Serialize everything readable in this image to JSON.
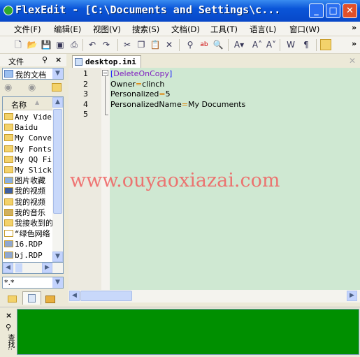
{
  "window": {
    "title": "FlexEdit - [C:\\Documents and Settings\\c...",
    "minimize": "_",
    "maximize": "□",
    "close": "✕"
  },
  "menu": [
    "文件(F)",
    "编辑(E)",
    "视图(V)",
    "搜索(S)",
    "文档(D)",
    "工具(T)",
    "语言(L)",
    "窗口(W)"
  ],
  "menu_overflow": "»",
  "toolbar": {
    "icons": [
      "new-icon",
      "open-icon",
      "save-icon",
      "save-all-icon",
      "print-icon",
      "undo-icon",
      "redo-icon",
      "cut-icon",
      "copy-icon",
      "paste-icon",
      "delete-icon",
      "find-icon",
      "replace-icon",
      "find-in-files-icon",
      "font-color-icon",
      "font-grow-icon",
      "font-shrink-icon",
      "word-wrap-icon",
      "pilcrow-icon",
      "folder-icon"
    ],
    "overflow": "»"
  },
  "left_panel": {
    "title": "文件",
    "location": "我的文档",
    "column_header": "名称",
    "items": [
      {
        "name": "Any Vide",
        "type": "folder"
      },
      {
        "name": "Baidu",
        "type": "folder"
      },
      {
        "name": "My Conve",
        "type": "folder"
      },
      {
        "name": "My Fonts",
        "type": "folder"
      },
      {
        "name": "My QQ Fi",
        "type": "folder"
      },
      {
        "name": "My Slick",
        "type": "folder"
      },
      {
        "name": "图片收藏",
        "type": "pictures"
      },
      {
        "name": "我的视频",
        "type": "video"
      },
      {
        "name": "我的视频",
        "type": "folder"
      },
      {
        "name": "我的音乐",
        "type": "music"
      },
      {
        "name": "我接收到的",
        "type": "folder"
      },
      {
        "name": "“绿色网络",
        "type": "doc"
      },
      {
        "name": "16.RDP",
        "type": "rdp"
      },
      {
        "name": "bj.RDP",
        "type": "rdp"
      }
    ],
    "filter": "*.*"
  },
  "editor": {
    "tab": "desktop.ini",
    "lines": [
      {
        "n": "1",
        "parts": [
          [
            "[",
            "#2020ff"
          ],
          [
            "DeleteOnCopy",
            "#8020c0"
          ],
          [
            "]",
            "#2020ff"
          ]
        ]
      },
      {
        "n": "2",
        "parts": [
          [
            "Owner",
            "#000"
          ],
          [
            "=",
            "#e08000"
          ],
          [
            "clinch",
            "#000"
          ]
        ]
      },
      {
        "n": "3",
        "parts": [
          [
            "Personalized",
            "#000"
          ],
          [
            "=",
            "#e08000"
          ],
          [
            "5",
            "#000"
          ]
        ]
      },
      {
        "n": "4",
        "parts": [
          [
            "PersonalizedName",
            "#000"
          ],
          [
            "=",
            "#e08000"
          ],
          [
            "My Documents",
            "#000"
          ]
        ]
      },
      {
        "n": "5",
        "parts": []
      }
    ]
  },
  "bottom_panel": {
    "label": "查找:"
  },
  "watermark": "www.ouyaoxiazai.com",
  "colors": {
    "title": "#0a55d8",
    "editor_bg": "#cfe8d2",
    "output_bg": "#008f00"
  }
}
